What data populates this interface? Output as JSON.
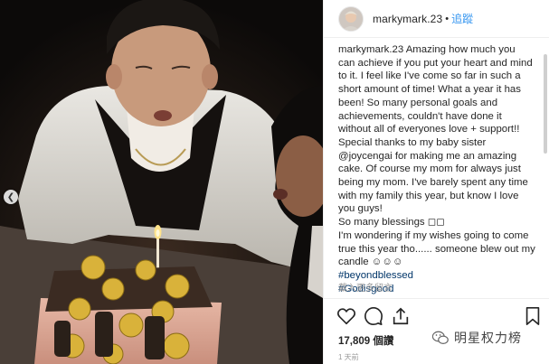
{
  "post": {
    "username": "markymark.23",
    "follow_label": "追蹤",
    "caption_user": "markymark.23",
    "caption_lines": [
      "Amazing how much you",
      "can achieve if you put your heart and mind",
      "to it. I feel like I've come so far in such a",
      "short amount of time! What a year it has",
      "been! So many personal goals and",
      "achievements, couldn't have done it",
      "without all of everyones love + support!!",
      "Special thanks to my baby sister",
      "@joycengai for making me an amazing",
      "cake. Of course my mom for always just",
      "being my mom. I've barely spent any time",
      "with my family this year, but know I love",
      "you guys!",
      "So many blessings ◻◻",
      "I'm wondering if my wishes going to come",
      "true this year tho...... someone blew out my",
      "candle ☺☺☺"
    ],
    "hashtags": [
      "#beyondblessed",
      "#Godisgood"
    ],
    "more_comments": "載入更多留言",
    "likes": "17,809 個讚",
    "time_ago": "1 天前"
  },
  "icons": {
    "like": "heart-icon",
    "comment": "comment-icon",
    "share": "share-icon",
    "save": "bookmark-icon",
    "carousel": "chevron-left-icon"
  },
  "watermark": {
    "text": "明星权力榜"
  },
  "colors": {
    "link": "#3897f0",
    "hashtag": "#003569",
    "text": "#262626",
    "muted": "#999999"
  }
}
